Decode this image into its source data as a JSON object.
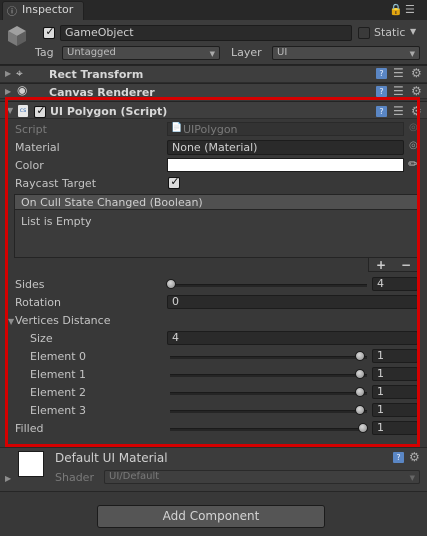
{
  "tab": {
    "label": "Inspector"
  },
  "gameobject": {
    "name": "GameObject",
    "static_label": "Static",
    "tag_label": "Tag",
    "tag_value": "Untagged",
    "layer_label": "Layer",
    "layer_value": "UI"
  },
  "components": {
    "rect_transform": {
      "title": "Rect Transform"
    },
    "canvas_renderer": {
      "title": "Canvas Renderer"
    },
    "ui_polygon": {
      "title": "UI Polygon (Script)"
    }
  },
  "props": {
    "script_label": "Script",
    "script_value": "UIPolygon",
    "material_label": "Material",
    "material_value": "None (Material)",
    "color_label": "Color",
    "color_value": "#ffffff",
    "raycast_label": "Raycast Target",
    "event_title": "On Cull State Changed (Boolean)",
    "event_empty": "List is Empty",
    "plus": "+",
    "minus": "−",
    "sides_label": "Sides",
    "sides_value": "4",
    "rotation_label": "Rotation",
    "rotation_value": "0",
    "vertices_label": "Vertices Distance",
    "size_label": "Size",
    "size_value": "4",
    "elements": [
      {
        "label": "Element 0",
        "value": "1",
        "level": 1.0
      },
      {
        "label": "Element 1",
        "value": "1",
        "level": 1.0
      },
      {
        "label": "Element 2",
        "value": "1",
        "level": 1.0
      },
      {
        "label": "Element 3",
        "value": "1",
        "level": 1.0
      }
    ],
    "filled_label": "Filled",
    "filled_value": "1",
    "sides_level": 0.0
  },
  "material_block": {
    "title": "Default UI Material",
    "shader_label": "Shader",
    "shader_value": "UI/Default"
  },
  "add_component": "Add Component",
  "colors": {
    "highlight_box": "#d50000",
    "panel_bg": "#383838"
  }
}
